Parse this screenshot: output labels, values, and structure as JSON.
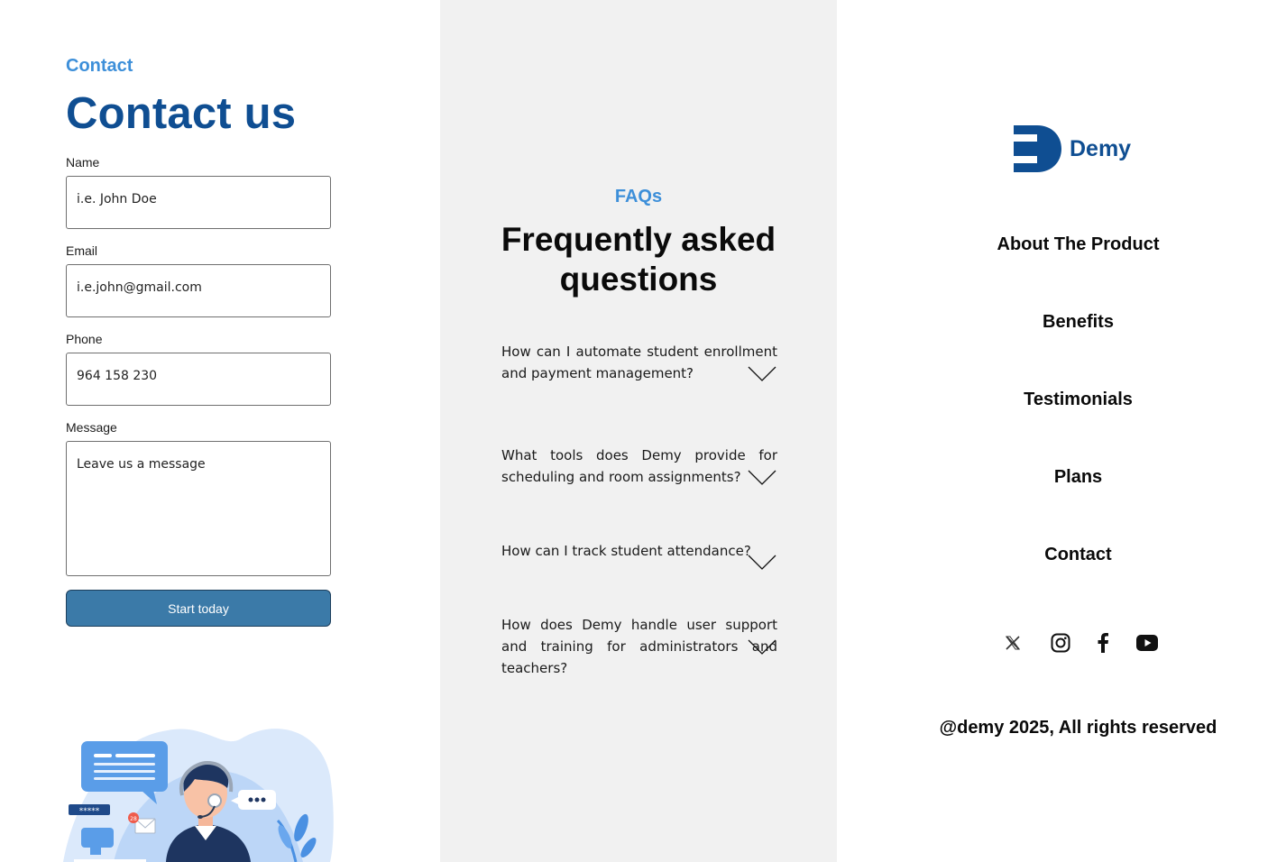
{
  "contact": {
    "eyebrow": "Contact",
    "title": "Contact us",
    "fields": [
      {
        "label": "Name",
        "placeholder": "i.e. John Doe"
      },
      {
        "label": "Email",
        "placeholder": "i.e.john@gmail.com"
      },
      {
        "label": "Phone",
        "placeholder": "964 158 230"
      },
      {
        "label": "Message",
        "placeholder": "Leave us a message"
      }
    ],
    "button_label": "Start today",
    "illustration": {
      "password_mask": "*****",
      "notification_count": "28"
    }
  },
  "faq": {
    "eyebrow": "FAQs",
    "title": "Frequently asked questions",
    "items": [
      {
        "question": "How can I automate student enrollment and payment management?"
      },
      {
        "question": "What tools does Demy provide for scheduling and room assignments?"
      },
      {
        "question": "How can I track student attendance?"
      },
      {
        "question": "How does Demy handle user support and training for administrators and teachers?"
      }
    ]
  },
  "footer": {
    "brand_name": "Demy",
    "nav": [
      "About The Product",
      "Benefits",
      "Testimonials",
      "Plans",
      "Contact"
    ],
    "social_icons": [
      "x-icon",
      "instagram-icon",
      "facebook-icon",
      "youtube-icon"
    ],
    "copyright": "@demy 2025, All rights reserved"
  },
  "colors": {
    "accent_light": "#3d8fd9",
    "brand_dark": "#0f4e92",
    "button": "#3b7aa8",
    "faq_bg": "#f1f1f1"
  }
}
